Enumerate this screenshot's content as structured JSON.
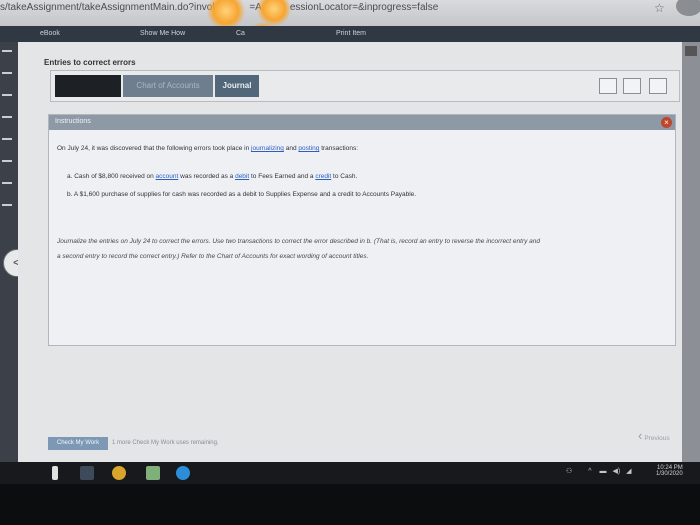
{
  "browser": {
    "url_start": "s/takeAssignment/takeAssignmentMain.do?invok",
    "url_mid": "=Ass",
    "url_end": "essionLocator=&inprogress=false",
    "star_icon": "star-icon"
  },
  "toolbar": {
    "ebook": "eBook",
    "show_me_how": "Show Me How",
    "calc": "Ca",
    "print_item": "Print Item"
  },
  "page": {
    "title": "Entries to correct errors",
    "tabs": {
      "chart_of_accounts": "Chart of Accounts",
      "journal": "Journal"
    }
  },
  "instructions": {
    "header": "Instructions",
    "intro_pre": "On July 24, it was discovered that the following errors took place in",
    "intro_link1": "journalizing",
    "intro_and": "and",
    "intro_link2": "posting",
    "intro_post": "transactions:",
    "a_pre": "a.  Cash of $8,800 received on",
    "a_link1": "account",
    "a_mid": "was recorded as a",
    "a_link2": "debit",
    "a_mid2": "to Fees Earned and a",
    "a_link3": "credit",
    "a_post": "to Cash.",
    "b": "b.  A $1,600 purchase of supplies for cash was recorded as a debit to Supplies Expense and a credit to Accounts Payable.",
    "journalize_line1": "Journalize the entries on July 24 to correct the errors. Use two transactions to correct the error described in b. (That is, record an entry to reverse the incorrect entry and",
    "journalize_line2": "a second entry to record the correct entry.) Refer to the Chart of Accounts for exact wording of account titles."
  },
  "footer": {
    "check_my_work": "Check My Work",
    "remaining": "1 more Check My Work uses remaining.",
    "previous": "Previous"
  },
  "taskbar": {
    "time": "10:24 PM",
    "date": "1/30/2020"
  }
}
